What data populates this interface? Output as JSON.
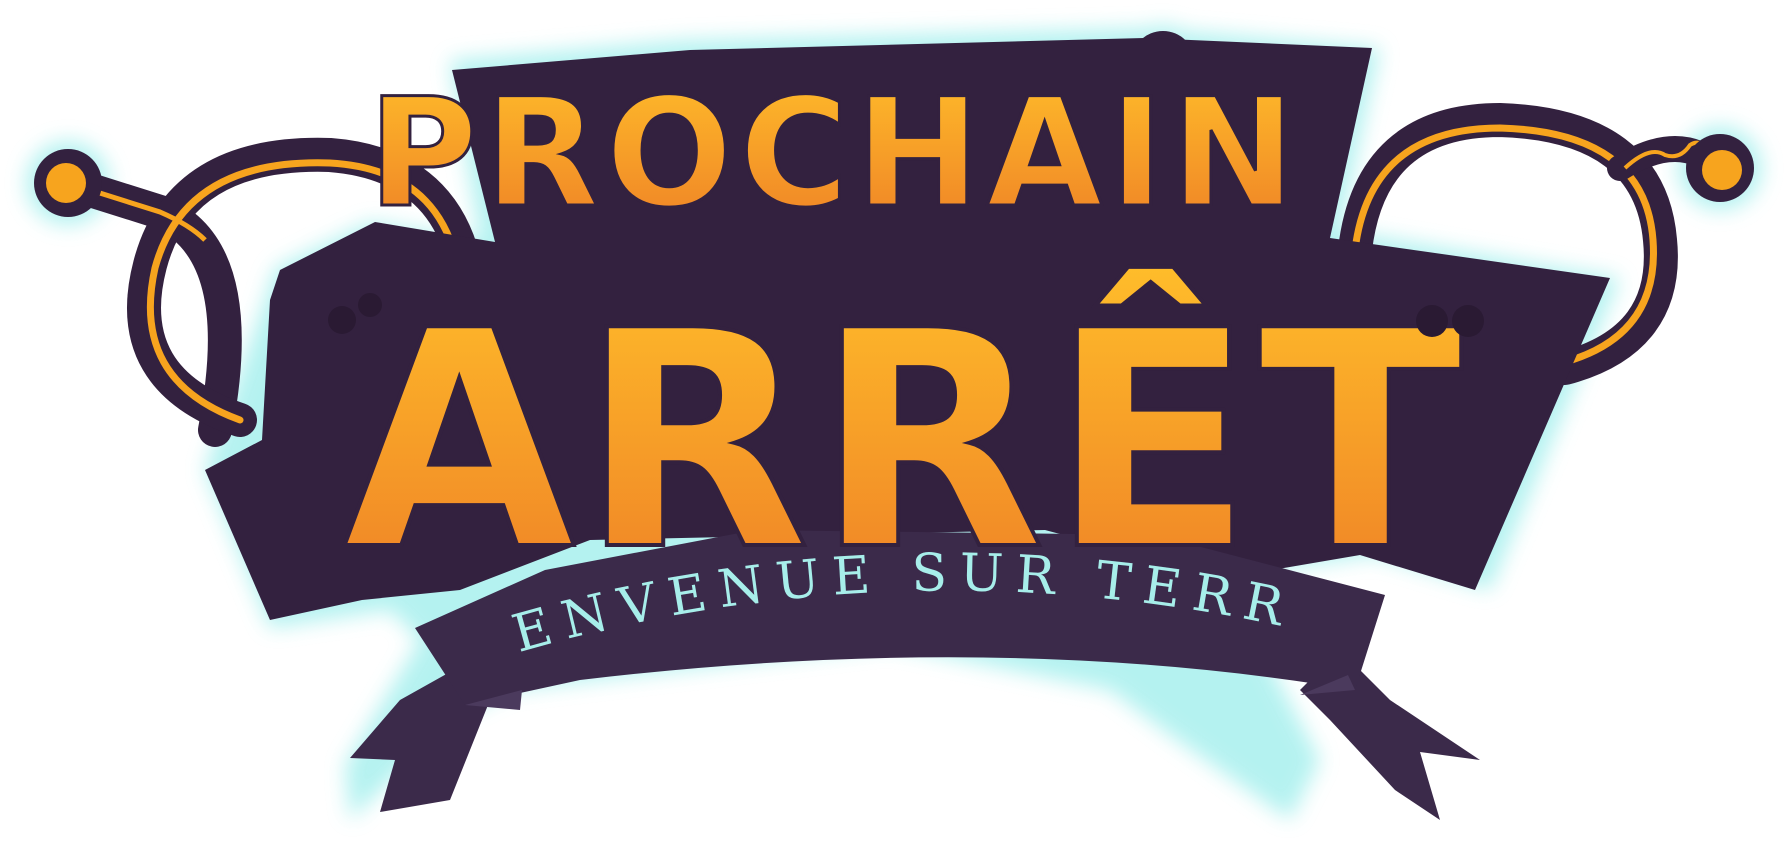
{
  "logo": {
    "line1": "PROCHAIN",
    "line2": "ARRÊT",
    "tagline": "BIENVENUE SUR TERRE!"
  },
  "colors": {
    "background": "#ffffff",
    "dark_purple": "#33213f",
    "ribbon_purple": "#3b2a4a",
    "ribbon_fold": "#4b3a5d",
    "orange_top": "#ffbd2a",
    "orange_bottom": "#ee7f26",
    "cyan_glow": "#a8f0ee",
    "cyan_text": "#a7eeea",
    "eye_dark": "#2a1a33",
    "antenna_orange": "#f7a41e"
  },
  "icons": [
    "antenna-left-icon",
    "antenna-right-icon",
    "eyes-icon"
  ]
}
